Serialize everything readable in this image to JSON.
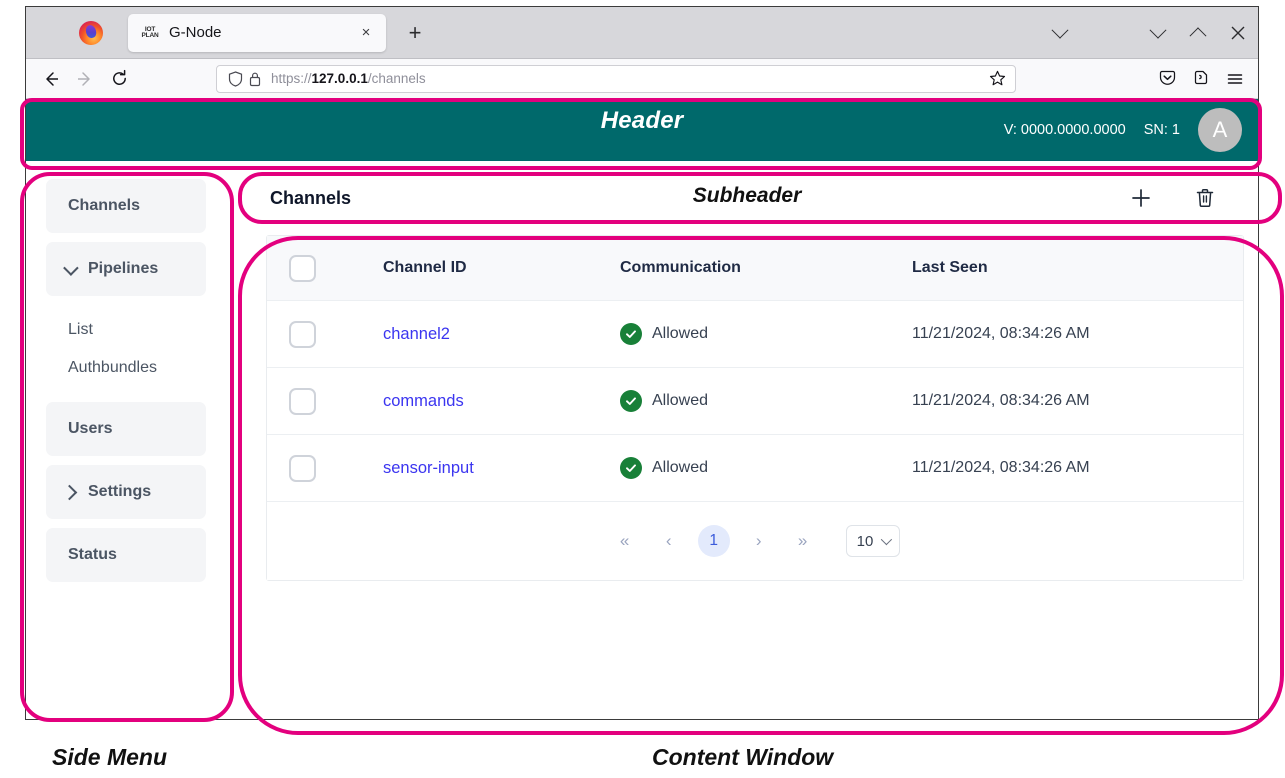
{
  "browser": {
    "tab": {
      "favicon_line1": "IOT",
      "favicon_line2": "PLAN",
      "title": "G-Node",
      "close_icon": "×"
    },
    "new_tab_icon": "+",
    "window_controls": {
      "tab_list_icon": "chevron-down",
      "minimize_icon": "chevron-down",
      "maximize_icon": "chevron-up",
      "close_icon": "×"
    },
    "nav": {
      "back_icon": "←",
      "forward_icon": "→",
      "reload_icon": "⟳",
      "shield_icon": "shield",
      "lock_icon": "lock",
      "url_scheme": "https://",
      "url_host": "127.0.0.1",
      "url_path": "/channels",
      "bookmark_icon": "☆",
      "pocket_icon": "pocket",
      "extensions_icon": "extensions",
      "menu_icon": "≡"
    }
  },
  "header": {
    "annotation": "Header",
    "version": "V: 0000.0000.0000",
    "serial": "SN: 1",
    "avatar_initial": "A"
  },
  "sidebar": {
    "items": [
      {
        "label": "Channels",
        "type": "item",
        "chevron": "none"
      },
      {
        "label": "Pipelines",
        "type": "group",
        "chevron": "down"
      },
      {
        "label": "List",
        "type": "sub"
      },
      {
        "label": "Authbundles",
        "type": "sub"
      },
      {
        "label": "Users",
        "type": "item",
        "chevron": "none"
      },
      {
        "label": "Settings",
        "type": "group",
        "chevron": "right"
      },
      {
        "label": "Status",
        "type": "item",
        "chevron": "none"
      }
    ]
  },
  "subheader": {
    "title": "Channels",
    "annotation": "Subheader",
    "add_icon": "+",
    "delete_icon": "trash"
  },
  "table": {
    "columns": [
      "Channel ID",
      "Communication",
      "Last Seen"
    ],
    "rows": [
      {
        "channel_id": "channel2",
        "communication": "Allowed",
        "last_seen": "11/21/2024, 08:34:26 AM"
      },
      {
        "channel_id": "commands",
        "communication": "Allowed",
        "last_seen": "11/21/2024, 08:34:26 AM"
      },
      {
        "channel_id": "sensor-input",
        "communication": "Allowed",
        "last_seen": "11/21/2024, 08:34:26 AM"
      }
    ]
  },
  "pagination": {
    "first_icon": "«",
    "prev_icon": "‹",
    "current_page": "1",
    "next_icon": "›",
    "last_icon": "»",
    "rows_per_page": "10"
  },
  "annotations": {
    "side_menu": "Side Menu",
    "content_window": "Content Window"
  },
  "colors": {
    "header_teal": "#00696b",
    "annotation_magenta": "#e3007e",
    "link_blue": "#3b35f0",
    "status_green": "#188038",
    "page_active_blue": "#3b5bdb"
  }
}
